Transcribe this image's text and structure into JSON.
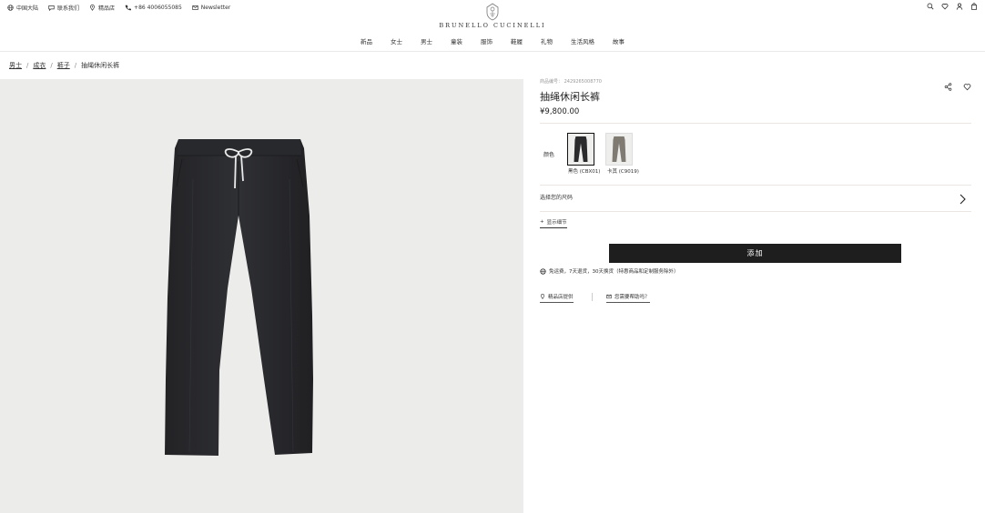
{
  "utility_bar": {
    "items": [
      {
        "icon": "globe-icon",
        "label": "中国大陆"
      },
      {
        "icon": "chat-icon",
        "label": "联系我们"
      },
      {
        "icon": "location-pin-icon",
        "label": "精品店"
      },
      {
        "icon": "phone-icon",
        "label": "+86 4006055085"
      },
      {
        "icon": "mail-icon",
        "label": "Newsletter"
      }
    ],
    "right_icons": [
      "search-icon",
      "heart-icon",
      "user-icon",
      "bag-icon"
    ]
  },
  "brand": {
    "wordmark": "BRUNELLO CUCINELLI"
  },
  "main_nav": [
    "新品",
    "女士",
    "男士",
    "童装",
    "服饰",
    "鞋履",
    "礼物",
    "生活风格",
    "故事"
  ],
  "breadcrumb": [
    "男士",
    "成衣",
    "裤子",
    "抽绳休闲长裤"
  ],
  "product": {
    "code": "商品编号： 2429265008770",
    "title": "抽绳休闲长裤",
    "price": "¥9,800.00",
    "color_label": "颜色",
    "colors": [
      {
        "label": "黑色 (CBX01)",
        "swatch": "#2a2a2c",
        "selected": true
      },
      {
        "label": "卡其 (C9019)",
        "swatch": "#7f7b73",
        "selected": false
      }
    ],
    "size_label": "选择您的尺码",
    "detail_link": "显示细节",
    "add_button": "添加",
    "shipping_text": "免运费，7天退货，30天换货（特惠商品和定制服务除外）",
    "store_link": "精品店提供",
    "help_link": "您需要帮助吗？"
  },
  "colors": {
    "image_bg": "#ececea",
    "button_bg": "#1e1e1e",
    "divider": "#ece6e2"
  }
}
